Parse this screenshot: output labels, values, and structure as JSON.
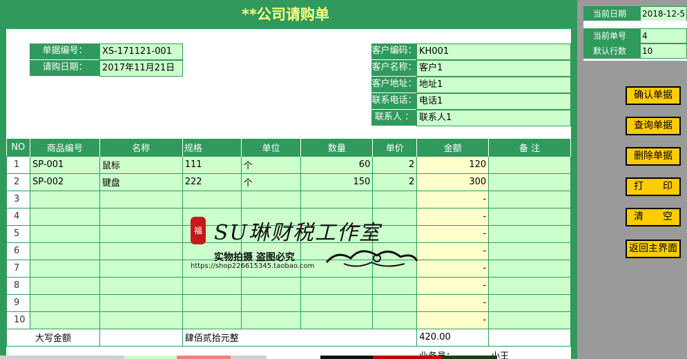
{
  "title": "**公司请购单",
  "header": {
    "doc_no_label": "单据编号：",
    "doc_no": "XS-171121-001",
    "date_label": "请购日期：",
    "date": "2017年11月21日"
  },
  "customer": {
    "code_label": "客户编码：",
    "code": "KH001",
    "name_label": "客户名称：",
    "name": "客户1",
    "address_label": "客户地址：",
    "address": "地址1",
    "phone_label": "联系电话：",
    "phone": "电话1",
    "contact_label": "联系人 ：",
    "contact": "联系人1"
  },
  "table": {
    "columns": [
      "NO",
      "商品编号",
      "名称",
      "规格",
      "单位",
      "数量",
      "单价",
      "金额",
      "备 注"
    ],
    "rows": [
      {
        "no": "1",
        "code": "SP-001",
        "name": "鼠标",
        "spec": "111",
        "unit": "个",
        "qty": "60",
        "price": "2",
        "amount": "120",
        "remark": ""
      },
      {
        "no": "2",
        "code": "SP-002",
        "name": "键盘",
        "spec": "222",
        "unit": "个",
        "qty": "150",
        "price": "2",
        "amount": "300",
        "remark": ""
      },
      {
        "no": "3",
        "code": "",
        "name": "",
        "spec": "",
        "unit": "",
        "qty": "",
        "price": "",
        "amount": "-",
        "remark": ""
      },
      {
        "no": "4",
        "code": "",
        "name": "",
        "spec": "",
        "unit": "",
        "qty": "",
        "price": "",
        "amount": "-",
        "remark": ""
      },
      {
        "no": "5",
        "code": "",
        "name": "",
        "spec": "",
        "unit": "",
        "qty": "",
        "price": "",
        "amount": "-",
        "remark": ""
      },
      {
        "no": "6",
        "code": "",
        "name": "",
        "spec": "",
        "unit": "",
        "qty": "",
        "price": "",
        "amount": "-",
        "remark": ""
      },
      {
        "no": "7",
        "code": "",
        "name": "",
        "spec": "",
        "unit": "",
        "qty": "",
        "price": "",
        "amount": "-",
        "remark": ""
      },
      {
        "no": "8",
        "code": "",
        "name": "",
        "spec": "",
        "unit": "",
        "qty": "",
        "price": "",
        "amount": "-",
        "remark": ""
      },
      {
        "no": "9",
        "code": "",
        "name": "",
        "spec": "",
        "unit": "",
        "qty": "",
        "price": "",
        "amount": "-",
        "remark": ""
      },
      {
        "no": "10",
        "code": "",
        "name": "",
        "spec": "",
        "unit": "",
        "qty": "",
        "price": "",
        "amount": "-",
        "remark": ""
      }
    ],
    "total_label": "大写金额",
    "total_words": "肆佰贰拾元整",
    "total_amount": "420.00"
  },
  "footer": {
    "sales_label": "业务员：",
    "sales_name": "小王"
  },
  "panel": {
    "current_date_label": "当前日期",
    "current_date": "2018-12-5",
    "current_no_label": "当前单号",
    "current_no": "4",
    "default_rows_label": "默认行数",
    "default_rows": "10",
    "buttons": [
      "确认单据",
      "查询单据",
      "删除单据",
      "打　　印",
      "清　　空",
      "返回主界面"
    ]
  },
  "watermark": {
    "logo_char": "福",
    "script": "SU琳财税工作室",
    "warning": "实物拍摄 盗图必究",
    "url": "https://shop226615345.taobao.com"
  },
  "colors": {
    "header_green": "#2f9a5c",
    "cell_green": "#ccffcc",
    "cell_yellow": "#ffffcc",
    "title_text": "#ffff80",
    "button_yellow": "#ffcc00",
    "panel_gray": "#9a9a9a"
  }
}
